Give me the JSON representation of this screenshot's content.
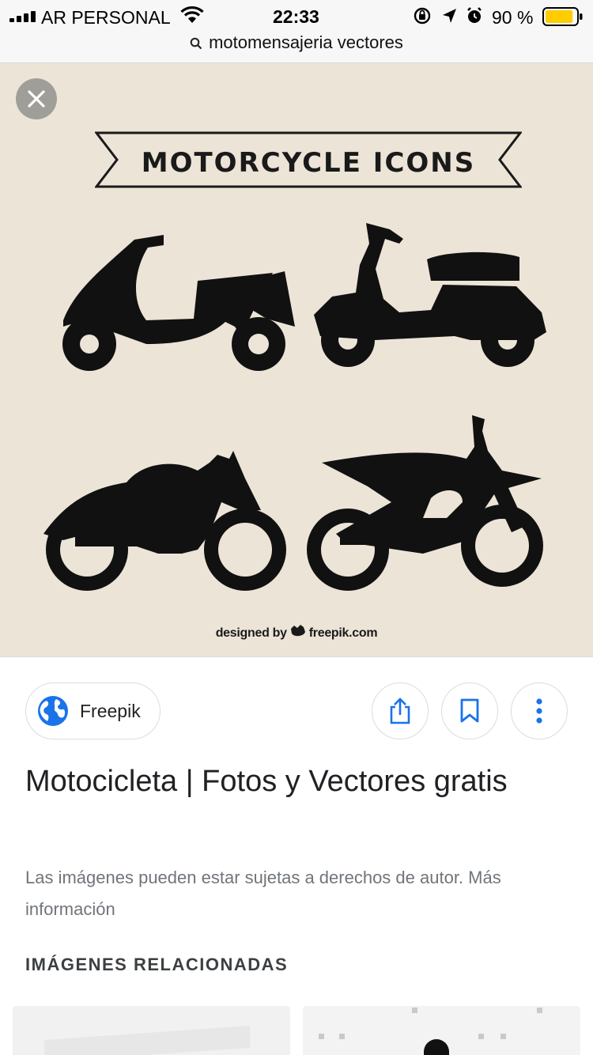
{
  "status_bar": {
    "carrier": "AR PERSONAL",
    "time": "22:33",
    "battery_percent": "90 %",
    "battery_level": 0.9,
    "icons": [
      "signal-icon",
      "wifi-icon",
      "screen-lock-icon",
      "location-icon",
      "alarm-icon",
      "battery-icon"
    ]
  },
  "url_bar": {
    "query": "motomensajeria vectores"
  },
  "viewer": {
    "image_title": "MOTORCYCLE ICONS",
    "credit_prefix": "designed by",
    "credit_brand": "freepik.com"
  },
  "source": {
    "name": "Freepik"
  },
  "result": {
    "title": "Motocicleta | Fotos y Vectores gratis",
    "copyright_text": "Las imágenes pueden estar sujetas a derechos de autor.",
    "more_info_label": "Más información"
  },
  "related": {
    "heading": "IMÁGENES RELACIONADAS"
  },
  "colors": {
    "accent": "#1a73e8",
    "image_bg": "#ece4d6",
    "battery": "#ffcc00"
  }
}
